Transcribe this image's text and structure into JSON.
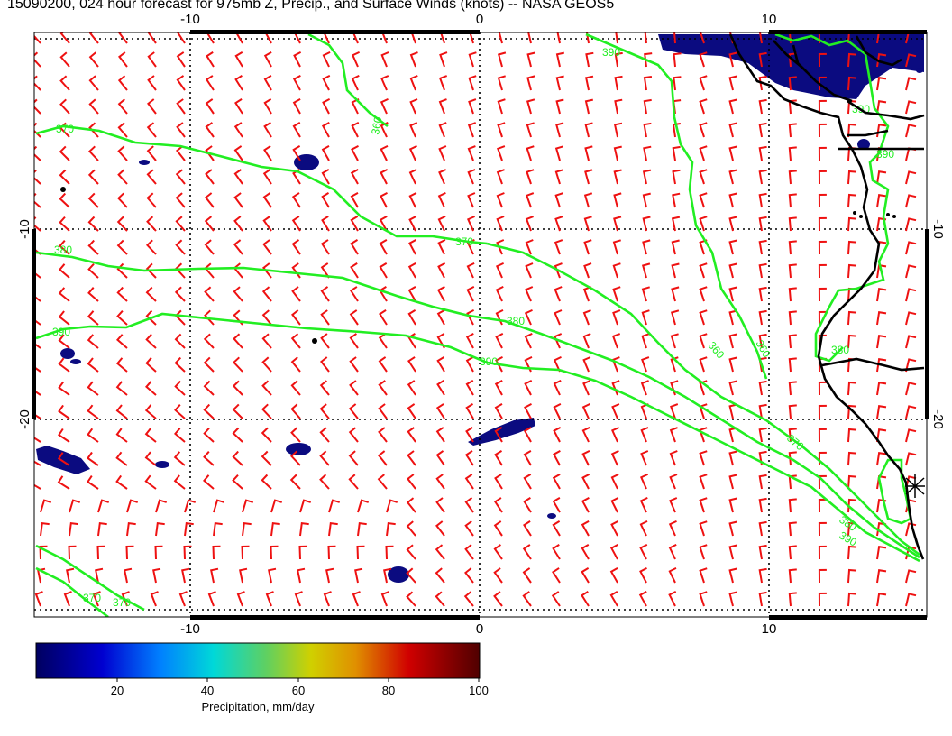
{
  "title": "15090200, 024 hour forecast for 975mb Z, Precip., and Surface Winds (knots) -- NASA GEOS5",
  "axes": {
    "x_ticks": [
      "-10",
      "0",
      "10"
    ],
    "y_ticks": [
      "-10",
      "-20"
    ]
  },
  "contour_labels": [
    "360",
    "370",
    "380",
    "390"
  ],
  "colorbar": {
    "title": "Precipitation, mm/day",
    "ticks": [
      "20",
      "40",
      "60",
      "80",
      "100"
    ],
    "range": [
      0,
      100
    ]
  },
  "colors": {
    "contour": "#22ee22",
    "barb": "#ee1111",
    "precip": "#0b0b80",
    "coast": "#000000"
  }
}
